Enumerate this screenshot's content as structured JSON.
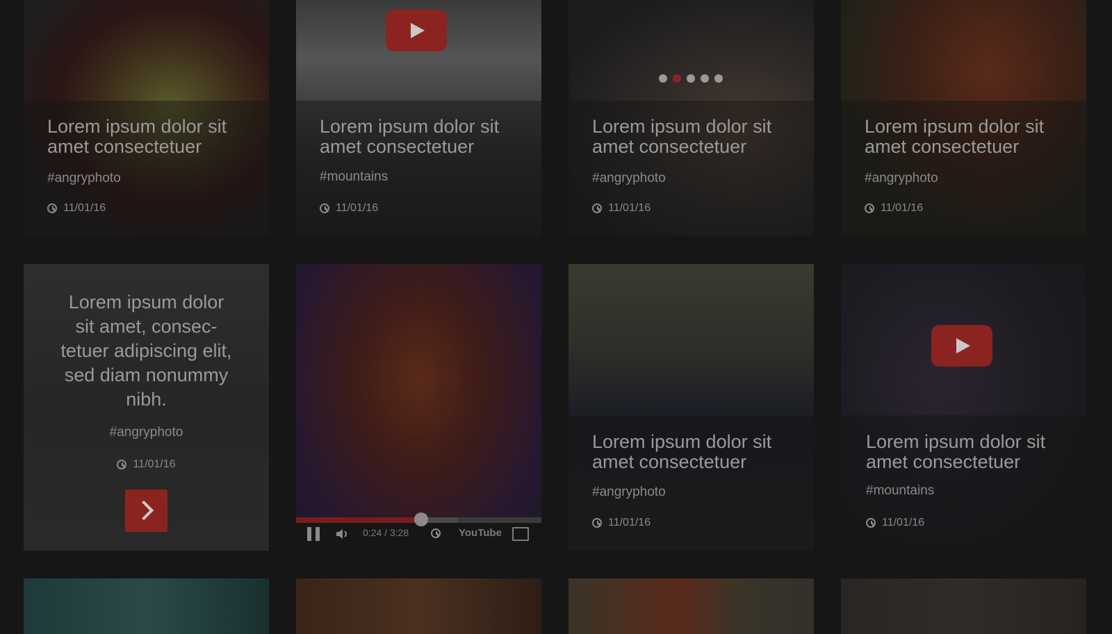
{
  "cards": {
    "r1c1": {
      "title": "Lorem ipsum dolor sit amet consectetuer",
      "tag": "#angryphoto",
      "date": "11/01/16"
    },
    "r1c2": {
      "title": "Lorem ipsum dolor sit amet consectetuer",
      "tag": "#mountains",
      "date": "11/01/16"
    },
    "r1c3": {
      "title": "Lorem ipsum dolor sit amet consectetuer",
      "tag": "#angryphoto",
      "date": "11/01/16",
      "slides": 5,
      "active_slide": 2
    },
    "r1c4": {
      "title": "Lorem ipsum dolor sit amet consectetuer",
      "tag": "#angryphoto",
      "date": "11/01/16"
    },
    "r2c1": {
      "title": "Lorem ipsum dolor sit amet, consec-tetuer adipiscing elit, sed diam nonummy nibh.",
      "tag": "#angryphoto",
      "date": "11/01/16"
    },
    "r2c2": {
      "current_time": "0:24",
      "separator": "/",
      "duration": "3:28",
      "progress": 0.51,
      "buffered": 0.66,
      "provider": "YouTube"
    },
    "r2c3": {
      "title": "Lorem ipsum dolor sit amet consectetuer",
      "tag": "#angryphoto",
      "date": "11/01/16"
    },
    "r2c4": {
      "title": "Lorem ipsum dolor sit amet consectetuer",
      "tag": "#mountains",
      "date": "11/01/16"
    }
  },
  "colors": {
    "accent": "#8b2420",
    "bg": "#161616",
    "text": "#9a9a9a"
  },
  "icons": [
    "clock-icon",
    "play-icon",
    "chevron-right-icon",
    "pause-icon",
    "volume-icon",
    "fullscreen-icon",
    "youtube-logo"
  ]
}
